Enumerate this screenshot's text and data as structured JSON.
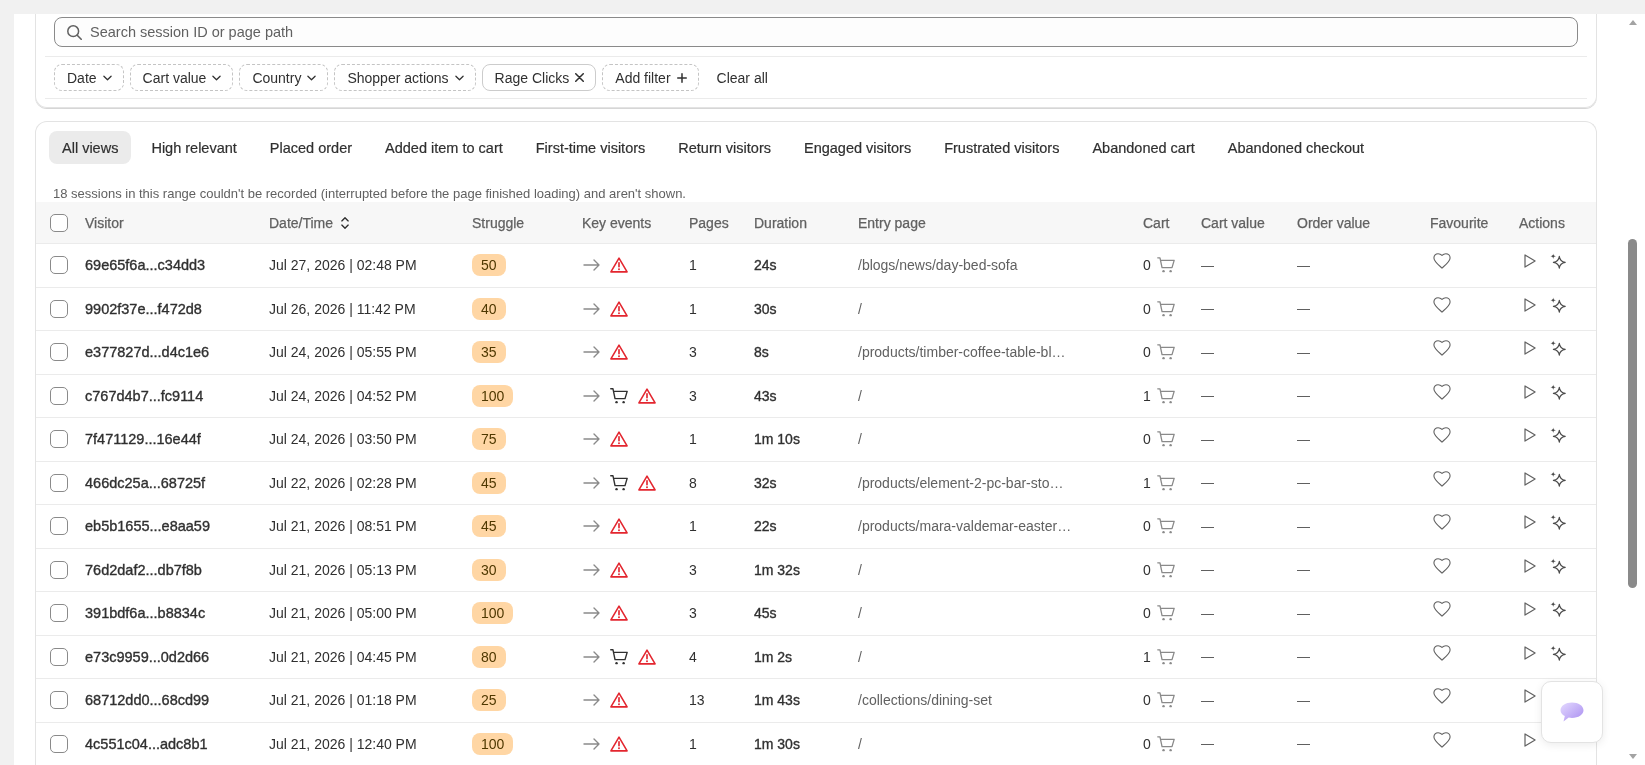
{
  "search": {
    "placeholder": "Search session ID or page path"
  },
  "filters": [
    {
      "label": "Date",
      "kind": "dropdown"
    },
    {
      "label": "Cart value",
      "kind": "dropdown"
    },
    {
      "label": "Country",
      "kind": "dropdown"
    },
    {
      "label": "Shopper actions",
      "kind": "dropdown"
    },
    {
      "label": "Rage Clicks",
      "kind": "applied"
    },
    {
      "label": "Add filter",
      "kind": "add"
    }
  ],
  "clear_all": {
    "label": "Clear all"
  },
  "tabs": [
    {
      "label": "All views",
      "selected": true
    },
    {
      "label": "High relevant",
      "selected": false
    },
    {
      "label": "Placed order",
      "selected": false
    },
    {
      "label": "Added item to cart",
      "selected": false
    },
    {
      "label": "First-time visitors",
      "selected": false
    },
    {
      "label": "Return visitors",
      "selected": false
    },
    {
      "label": "Engaged visitors",
      "selected": false
    },
    {
      "label": "Frustrated visitors",
      "selected": false
    },
    {
      "label": "Abandoned cart",
      "selected": false
    },
    {
      "label": "Abandoned checkout",
      "selected": false
    }
  ],
  "notice": "18 sessions in this range couldn't be recorded (interrupted before the page finished loading) and aren't shown.",
  "table": {
    "select_all": {
      "checked": false
    },
    "columns": [
      {
        "label": "Visitor",
        "sortable": false
      },
      {
        "label": "Date/Time",
        "sortable": true
      },
      {
        "label": "Struggle",
        "sortable": false
      },
      {
        "label": "Key events",
        "sortable": false
      },
      {
        "label": "Pages",
        "sortable": false
      },
      {
        "label": "Duration",
        "sortable": false
      },
      {
        "label": "Entry page",
        "sortable": false
      },
      {
        "label": "Cart",
        "sortable": false
      },
      {
        "label": "Cart value",
        "sortable": false
      },
      {
        "label": "Order value",
        "sortable": false
      },
      {
        "label": "Favourite",
        "sortable": false
      },
      {
        "label": "Actions",
        "sortable": false
      }
    ],
    "rows": [
      {
        "checked": false,
        "visitor": "69e65f6a...c34dd3",
        "datetime": "Jul 27, 2026 | 02:48 PM",
        "struggle": "50",
        "key_events": [
          {
            "kind": "entered"
          },
          {
            "kind": "rage_click"
          }
        ],
        "pages": "1",
        "duration": "24s",
        "entry_page": "/blogs/news/day-bed-sofa",
        "cart": "0",
        "cart_value": "—",
        "order_value": "—",
        "favourite": false,
        "actions": [
          {
            "kind": "play"
          },
          {
            "kind": "ai"
          }
        ]
      },
      {
        "checked": false,
        "visitor": "9902f37e...f472d8",
        "datetime": "Jul 26, 2026 | 11:42 PM",
        "struggle": "40",
        "key_events": [
          {
            "kind": "entered"
          },
          {
            "kind": "rage_click"
          }
        ],
        "pages": "1",
        "duration": "30s",
        "entry_page": "/",
        "cart": "0",
        "cart_value": "—",
        "order_value": "—",
        "favourite": false,
        "actions": [
          {
            "kind": "play"
          },
          {
            "kind": "ai"
          }
        ]
      },
      {
        "checked": false,
        "visitor": "e377827d...d4c1e6",
        "datetime": "Jul 24, 2026 | 05:55 PM",
        "struggle": "35",
        "key_events": [
          {
            "kind": "entered"
          },
          {
            "kind": "rage_click"
          }
        ],
        "pages": "3",
        "duration": "8s",
        "entry_page": "/products/timber-coffee-table-bl…",
        "cart": "0",
        "cart_value": "—",
        "order_value": "—",
        "favourite": false,
        "actions": [
          {
            "kind": "play"
          },
          {
            "kind": "ai"
          }
        ]
      },
      {
        "checked": false,
        "visitor": "c767d4b7...fc9114",
        "datetime": "Jul 24, 2026 | 04:52 PM",
        "struggle": "100",
        "key_events": [
          {
            "kind": "entered"
          },
          {
            "kind": "added_to_cart"
          },
          {
            "kind": "rage_click"
          }
        ],
        "pages": "3",
        "duration": "43s",
        "entry_page": "/",
        "cart": "1",
        "cart_value": "—",
        "order_value": "—",
        "favourite": false,
        "actions": [
          {
            "kind": "play"
          },
          {
            "kind": "ai"
          }
        ]
      },
      {
        "checked": false,
        "visitor": "7f471129...16e44f",
        "datetime": "Jul 24, 2026 | 03:50 PM",
        "struggle": "75",
        "key_events": [
          {
            "kind": "entered"
          },
          {
            "kind": "rage_click"
          }
        ],
        "pages": "1",
        "duration": "1m 10s",
        "entry_page": "/",
        "cart": "0",
        "cart_value": "—",
        "order_value": "—",
        "favourite": false,
        "actions": [
          {
            "kind": "play"
          },
          {
            "kind": "ai"
          }
        ]
      },
      {
        "checked": false,
        "visitor": "466dc25a...68725f",
        "datetime": "Jul 22, 2026 | 02:28 PM",
        "struggle": "45",
        "key_events": [
          {
            "kind": "entered"
          },
          {
            "kind": "added_to_cart"
          },
          {
            "kind": "rage_click"
          }
        ],
        "pages": "8",
        "duration": "32s",
        "entry_page": "/products/element-2-pc-bar-sto…",
        "cart": "1",
        "cart_value": "—",
        "order_value": "—",
        "favourite": false,
        "actions": [
          {
            "kind": "play"
          },
          {
            "kind": "ai"
          }
        ]
      },
      {
        "checked": false,
        "visitor": "eb5b1655...e8aa59",
        "datetime": "Jul 21, 2026 | 08:51 PM",
        "struggle": "45",
        "key_events": [
          {
            "kind": "entered"
          },
          {
            "kind": "rage_click"
          }
        ],
        "pages": "1",
        "duration": "22s",
        "entry_page": "/products/mara-valdemar-easter…",
        "cart": "0",
        "cart_value": "—",
        "order_value": "—",
        "favourite": false,
        "actions": [
          {
            "kind": "play"
          },
          {
            "kind": "ai"
          }
        ]
      },
      {
        "checked": false,
        "visitor": "76d2daf2...db7f8b",
        "datetime": "Jul 21, 2026 | 05:13 PM",
        "struggle": "30",
        "key_events": [
          {
            "kind": "entered"
          },
          {
            "kind": "rage_click"
          }
        ],
        "pages": "3",
        "duration": "1m 32s",
        "entry_page": "/",
        "cart": "0",
        "cart_value": "—",
        "order_value": "—",
        "favourite": false,
        "actions": [
          {
            "kind": "play"
          },
          {
            "kind": "ai"
          }
        ]
      },
      {
        "checked": false,
        "visitor": "391bdf6a...b8834c",
        "datetime": "Jul 21, 2026 | 05:00 PM",
        "struggle": "100",
        "key_events": [
          {
            "kind": "entered"
          },
          {
            "kind": "rage_click"
          }
        ],
        "pages": "3",
        "duration": "45s",
        "entry_page": "/",
        "cart": "0",
        "cart_value": "—",
        "order_value": "—",
        "favourite": false,
        "actions": [
          {
            "kind": "play"
          },
          {
            "kind": "ai"
          }
        ]
      },
      {
        "checked": false,
        "visitor": "e73c9959...0d2d66",
        "datetime": "Jul 21, 2026 | 04:45 PM",
        "struggle": "80",
        "key_events": [
          {
            "kind": "entered"
          },
          {
            "kind": "added_to_cart"
          },
          {
            "kind": "rage_click"
          }
        ],
        "pages": "4",
        "duration": "1m 2s",
        "entry_page": "/",
        "cart": "1",
        "cart_value": "—",
        "order_value": "—",
        "favourite": false,
        "actions": [
          {
            "kind": "play"
          },
          {
            "kind": "ai"
          }
        ]
      },
      {
        "checked": false,
        "visitor": "68712dd0...68cd99",
        "datetime": "Jul 21, 2026 | 01:18 PM",
        "struggle": "25",
        "key_events": [
          {
            "kind": "entered"
          },
          {
            "kind": "rage_click"
          }
        ],
        "pages": "13",
        "duration": "1m 43s",
        "entry_page": "/collections/dining-set",
        "cart": "0",
        "cart_value": "—",
        "order_value": "—",
        "favourite": false,
        "actions": [
          {
            "kind": "play"
          }
        ]
      },
      {
        "checked": false,
        "visitor": "4c551c04...adc8b1",
        "datetime": "Jul 21, 2026 | 12:40 PM",
        "struggle": "100",
        "key_events": [
          {
            "kind": "entered"
          },
          {
            "kind": "rage_click"
          }
        ],
        "pages": "1",
        "duration": "1m 30s",
        "entry_page": "/",
        "cart": "0",
        "cart_value": "—",
        "order_value": "—",
        "favourite": false,
        "actions": [
          {
            "kind": "play"
          }
        ]
      }
    ]
  }
}
